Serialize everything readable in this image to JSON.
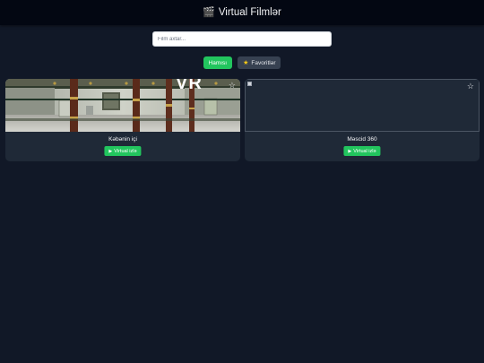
{
  "header": {
    "title": "Virtual Filmlər",
    "icon": "clapperboard-icon"
  },
  "search": {
    "placeholder": "Film axtar...",
    "value": ""
  },
  "filters": {
    "all_label": "Hamısı",
    "favorites_label": "Favoritlər",
    "active": "all"
  },
  "colors": {
    "accent": "#22c55e",
    "background": "#111827",
    "card": "#1f2937",
    "header": "#030712"
  },
  "cards": [
    {
      "title": "Kəbənin içi",
      "watch_label": "Virtual izlə",
      "favorite": false,
      "overlay_text": "VR"
    },
    {
      "title": "Məscid 360",
      "watch_label": "Virtual izlə",
      "favorite": false
    }
  ]
}
